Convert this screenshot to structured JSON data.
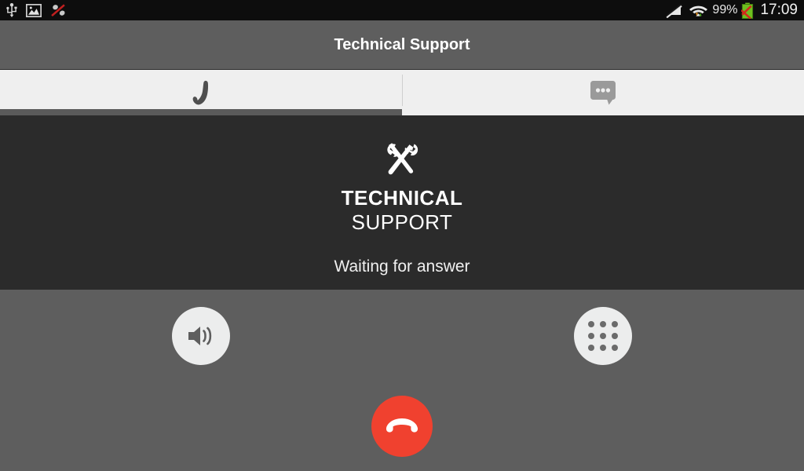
{
  "status_bar": {
    "left_icons": [
      {
        "name": "usb-icon",
        "label": "USB connected"
      },
      {
        "name": "screenshot-image-icon",
        "label": "Screenshot captured"
      },
      {
        "name": "sound-mute-icon",
        "label": "Sound off"
      }
    ],
    "signal_icon": "signal-off-icon",
    "wifi_icon": "wifi-data-icon",
    "battery_percent": "99%",
    "battery_icon": "battery-error-icon",
    "time": "17:09"
  },
  "title_bar": {
    "title": "Technical Support"
  },
  "tabs": [
    {
      "id": "call",
      "icon": "phone-icon",
      "label": "Call",
      "active": true
    },
    {
      "id": "chat",
      "icon": "chat-bubble-icon",
      "label": "Chat",
      "active": false
    }
  ],
  "call": {
    "brand_icon": "tools-icon",
    "brand_line1": "TECHNICAL",
    "brand_line2": "SUPPORT",
    "status": "Waiting for answer"
  },
  "controls": {
    "speaker": {
      "icon": "speaker-icon",
      "label": "Speaker"
    },
    "keypad": {
      "icon": "dialpad-icon",
      "label": "Keypad"
    },
    "end_call": {
      "icon": "end-call-icon",
      "label": "End call"
    }
  },
  "colors": {
    "status_bar_bg": "#0d0d0d",
    "title_bar_bg": "#5e5e5e",
    "tab_bar_bg": "#efefef",
    "panel_bg": "#2b2b2b",
    "controls_bg": "#5e5e5e",
    "end_call_red": "#f0412f",
    "button_light": "#eceded",
    "active_tab_underline": "#5a5a5a"
  }
}
